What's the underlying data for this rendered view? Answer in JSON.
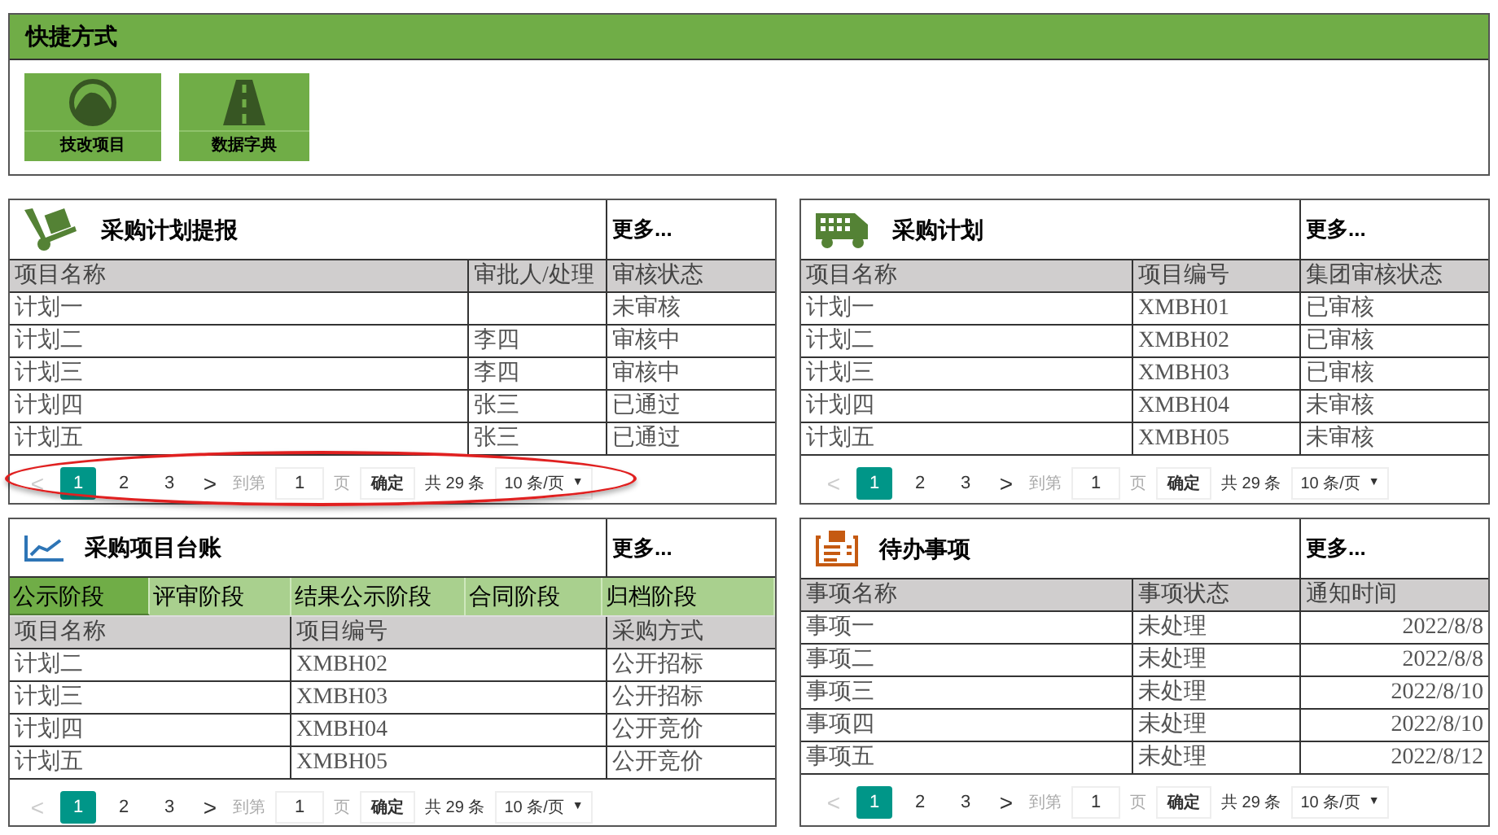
{
  "shortcuts": {
    "title": "快捷方式",
    "items": [
      {
        "label": "技改项目"
      },
      {
        "label": "数据字典"
      }
    ]
  },
  "panels": [
    {
      "title": "采购计划提报",
      "more": "更多...",
      "columns": [
        {
          "label": "项目名称"
        },
        {
          "label": "审批人/处理"
        },
        {
          "label": "审核状态"
        }
      ],
      "rows": [
        [
          "计划一",
          "",
          "未审核"
        ],
        [
          "计划二",
          "李四",
          "审核中"
        ],
        [
          "计划三",
          "李四",
          "审核中"
        ],
        [
          "计划四",
          "张三",
          "已通过"
        ],
        [
          "计划五",
          "张三",
          "已通过"
        ]
      ],
      "pagination": {
        "prev": {
          "label": "<",
          "disabled": true
        },
        "pages": [
          {
            "label": "1",
            "selected": true
          },
          {
            "label": "2",
            "selected": false
          },
          {
            "label": "3",
            "selected": false
          }
        ],
        "next": {
          "label": ">",
          "disabled": false
        },
        "goto_label": "到第",
        "page_input": "1",
        "page_unit": "页",
        "confirm": "确定",
        "total": "共 29 条",
        "page_size": "10 条/页",
        "dropdown": "▼"
      }
    },
    {
      "title": "采购计划",
      "more": "更多...",
      "columns": [
        {
          "label": "项目名称"
        },
        {
          "label": "项目编号"
        },
        {
          "label": "集团审核状态"
        }
      ],
      "rows": [
        [
          "计划一",
          "XMBH01",
          "已审核"
        ],
        [
          "计划二",
          "XMBH02",
          "已审核"
        ],
        [
          "计划三",
          "XMBH03",
          "已审核"
        ],
        [
          "计划四",
          "XMBH04",
          "未审核"
        ],
        [
          "计划五",
          "XMBH05",
          "未审核"
        ]
      ],
      "pagination": {
        "prev": {
          "label": "<",
          "disabled": true
        },
        "pages": [
          {
            "label": "1",
            "selected": true
          },
          {
            "label": "2",
            "selected": false
          },
          {
            "label": "3",
            "selected": false
          }
        ],
        "next": {
          "label": ">",
          "disabled": false
        },
        "goto_label": "到第",
        "page_input": "1",
        "page_unit": "页",
        "confirm": "确定",
        "total": "共 29 条",
        "page_size": "10 条/页",
        "dropdown": "▼"
      }
    },
    {
      "title": "采购项目台账",
      "more": "更多...",
      "tabs": [
        {
          "label": "公示阶段",
          "selected": true
        },
        {
          "label": "评审阶段",
          "selected": false
        },
        {
          "label": "结果公示阶段",
          "selected": false
        },
        {
          "label": "合同阶段",
          "selected": false
        },
        {
          "label": "归档阶段",
          "selected": false
        }
      ],
      "columns": [
        {
          "label": "项目名称"
        },
        {
          "label": "项目编号"
        },
        {
          "label": "采购方式"
        }
      ],
      "rows": [
        [
          "计划二",
          "XMBH02",
          "公开招标"
        ],
        [
          "计划三",
          "XMBH03",
          "公开招标"
        ],
        [
          "计划四",
          "XMBH04",
          "公开竞价"
        ],
        [
          "计划五",
          "XMBH05",
          "公开竞价"
        ]
      ],
      "pagination": {
        "prev": {
          "label": "<",
          "disabled": true
        },
        "pages": [
          {
            "label": "1",
            "selected": true
          },
          {
            "label": "2",
            "selected": false
          },
          {
            "label": "3",
            "selected": false
          }
        ],
        "next": {
          "label": ">",
          "disabled": false
        },
        "goto_label": "到第",
        "page_input": "1",
        "page_unit": "页",
        "confirm": "确定",
        "total": "共 29 条",
        "page_size": "10 条/页",
        "dropdown": "▼"
      }
    },
    {
      "title": "待办事项",
      "more": "更多...",
      "columns": [
        {
          "label": "事项名称"
        },
        {
          "label": "事项状态"
        },
        {
          "label": "通知时间",
          "kind": "date"
        }
      ],
      "rows": [
        [
          "事项一",
          "未处理",
          "2022/8/8"
        ],
        [
          "事项二",
          "未处理",
          "2022/8/8"
        ],
        [
          "事项三",
          "未处理",
          "2022/8/10"
        ],
        [
          "事项四",
          "未处理",
          "2022/8/10"
        ],
        [
          "事项五",
          "未处理",
          "2022/8/12"
        ]
      ],
      "pagination": {
        "prev": {
          "label": "<",
          "disabled": true
        },
        "pages": [
          {
            "label": "1",
            "selected": true
          },
          {
            "label": "2",
            "selected": false
          },
          {
            "label": "3",
            "selected": false
          }
        ],
        "next": {
          "label": ">",
          "disabled": false
        },
        "goto_label": "到第",
        "page_input": "1",
        "page_unit": "页",
        "confirm": "确定",
        "total": "共 29 条",
        "page_size": "10 条/页",
        "dropdown": "▼"
      }
    }
  ]
}
